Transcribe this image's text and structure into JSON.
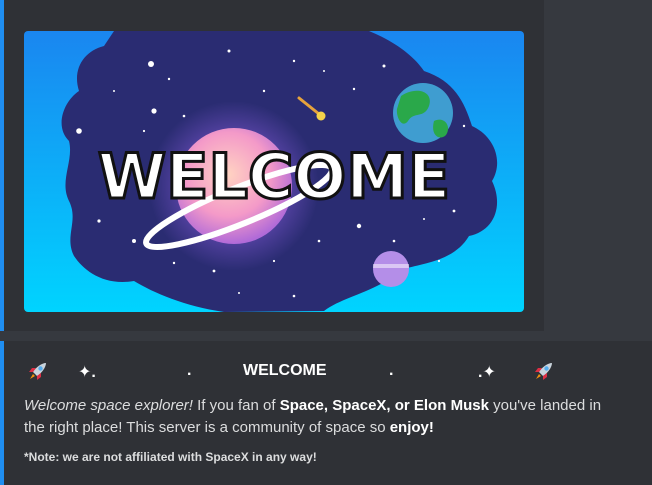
{
  "banner": {
    "title": "WELCOME"
  },
  "embed": {
    "title_sparkle_left": "✦.",
    "title_dot1": ".",
    "title": "WELCOME",
    "title_dot2": ".",
    "title_sparkle_right": ".✦",
    "description": {
      "intro_italic": "Welcome space explorer!",
      "text1": " If you fan of ",
      "bold1": "Space, SpaceX, or Elon Musk",
      "text2": " you've landed in the right place! This server is a community of space so ",
      "bold2": "enjoy!"
    },
    "note": "*Note: we are not affiliated with SpaceX in any way!"
  },
  "colors": {
    "background": "#36393f",
    "embed_background": "#2f3136",
    "accent_bar": "#1f8ef1",
    "banner_sky": "#00c6ff",
    "banner_space": "#2a2c72"
  }
}
